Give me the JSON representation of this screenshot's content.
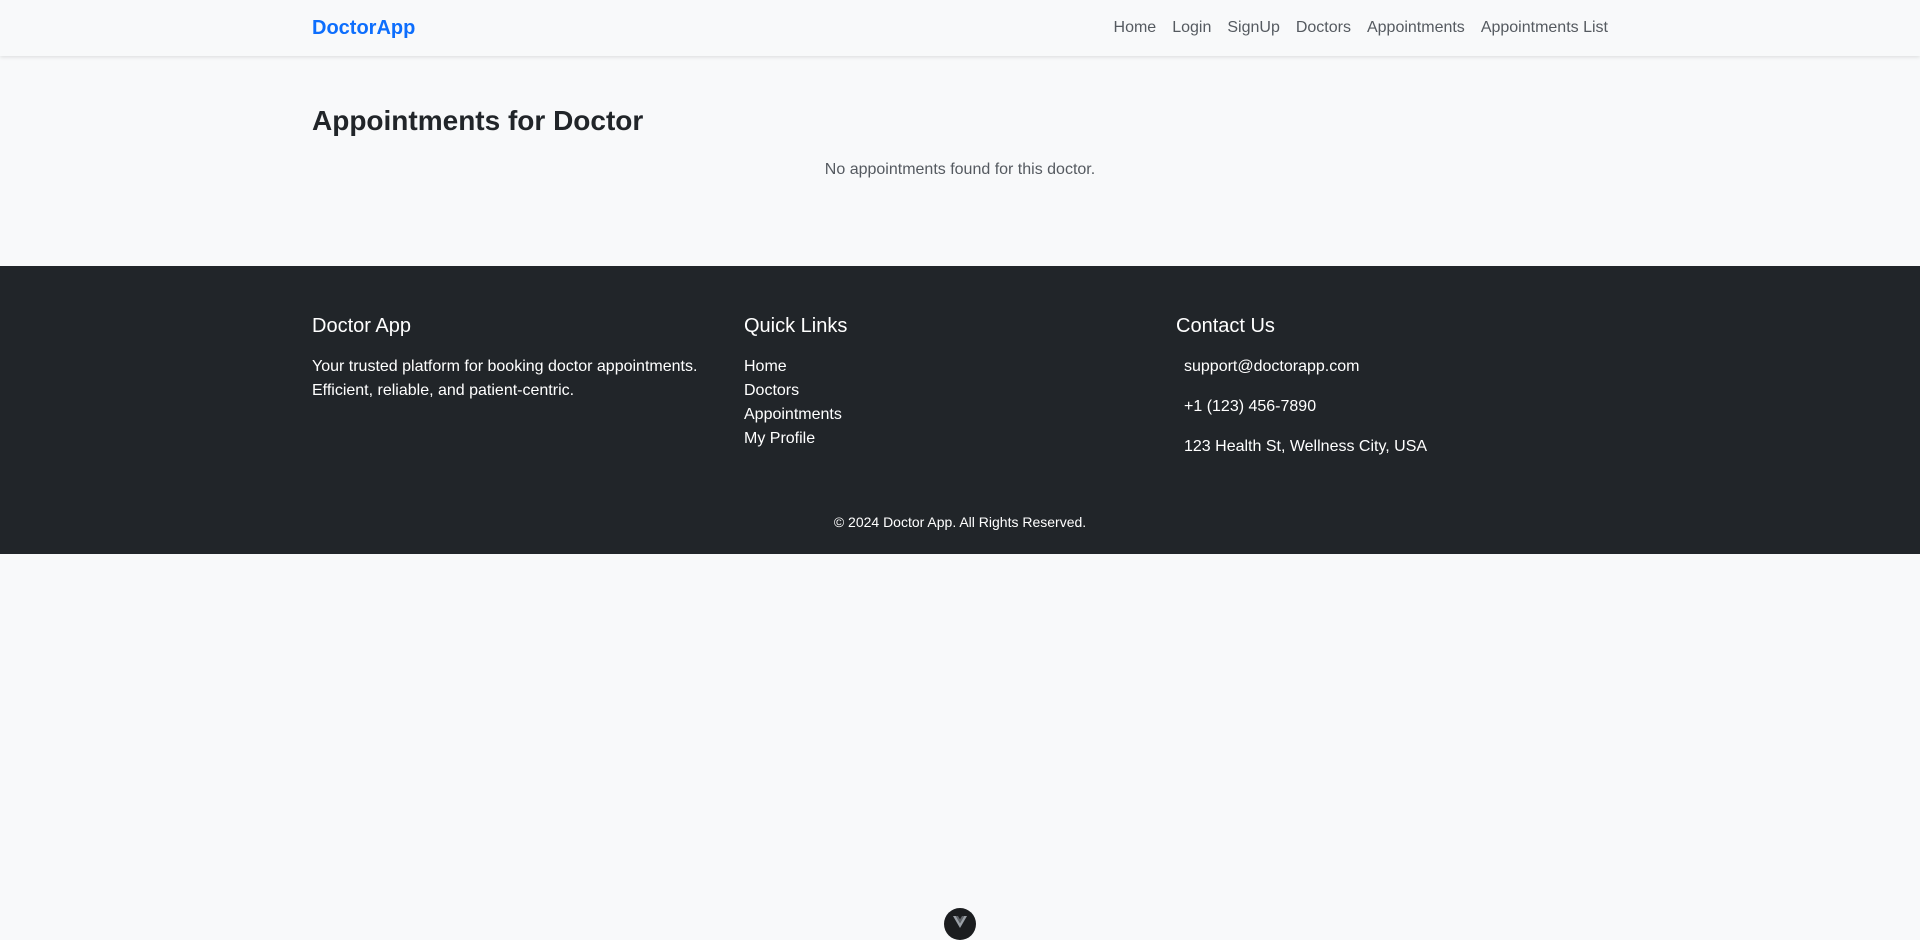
{
  "navbar": {
    "brand": "DoctorApp",
    "links": [
      {
        "label": "Home"
      },
      {
        "label": "Login"
      },
      {
        "label": "SignUp"
      },
      {
        "label": "Doctors"
      },
      {
        "label": "Appointments"
      },
      {
        "label": "Appointments List"
      }
    ]
  },
  "main": {
    "title": "Appointments for Doctor",
    "empty_message": "No appointments found for this doctor."
  },
  "footer": {
    "about": {
      "heading": "Doctor App",
      "line1": "Your trusted platform for booking doctor appointments.",
      "line2": "Efficient, reliable, and patient-centric."
    },
    "quick_links": {
      "heading": "Quick Links",
      "links": [
        {
          "label": "Home"
        },
        {
          "label": "Doctors"
        },
        {
          "label": "Appointments"
        },
        {
          "label": "My Profile"
        }
      ]
    },
    "contact": {
      "heading": "Contact Us",
      "email": "support@doctorapp.com",
      "phone": "+1 (123) 456-7890",
      "address": "123 Health St, Wellness City, USA"
    },
    "copyright": "© 2024 Doctor App. All Rights Reserved."
  },
  "floating_badge": {
    "icon": "vue-logo-icon"
  }
}
